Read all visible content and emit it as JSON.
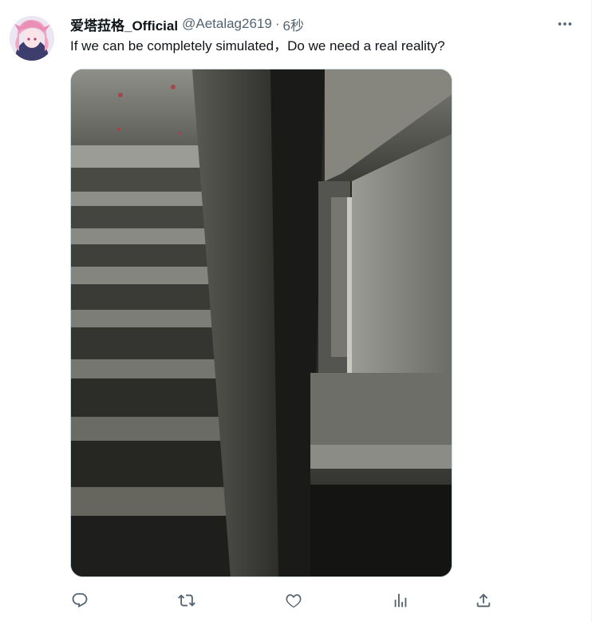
{
  "tweet": {
    "display_name": "爱塔菈格_Official",
    "handle": "@Aetalag2619",
    "separator": "·",
    "time": "6秒",
    "text": "If we can be completely simulated，Do we need a real reality?",
    "more_icon": "more-horizontal-icon",
    "avatar": "anime-avatar-pink-hair"
  },
  "media": {
    "kind": "photo",
    "description_icon": "stairwell-photo"
  },
  "actions": [
    {
      "name": "reply-button",
      "icon": "reply-icon"
    },
    {
      "name": "retweet-button",
      "icon": "retweet-icon"
    },
    {
      "name": "like-button",
      "icon": "heart-icon"
    },
    {
      "name": "views-button",
      "icon": "analytics-icon"
    },
    {
      "name": "share-button",
      "icon": "share-icon"
    }
  ],
  "colors": {
    "text": "#0f1419",
    "secondary": "#536471",
    "border": "#cfd9de"
  }
}
